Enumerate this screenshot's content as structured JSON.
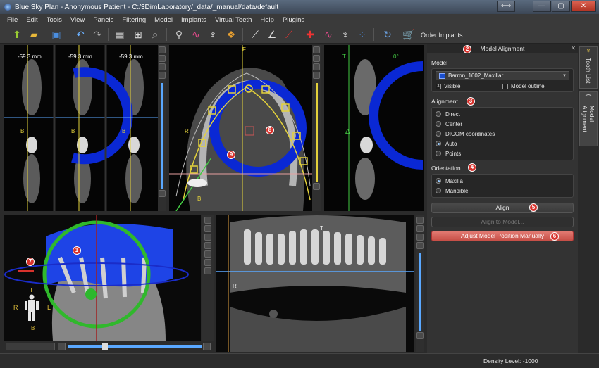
{
  "window": {
    "title": "Blue Sky Plan - Anonymous Patient - C:/3DimLaboratory/_data/_manual/data/default",
    "buttons": [
      "⟷",
      "—",
      "▢",
      "✕"
    ]
  },
  "menu": [
    "File",
    "Edit",
    "Tools",
    "View",
    "Panels",
    "Filtering",
    "Model",
    "Implants",
    "Virtual Teeth",
    "Help",
    "Plugins"
  ],
  "toolbar": {
    "order_label": "Order Implants"
  },
  "views": {
    "measures": [
      "-59.3 mm",
      "-59.3 mm",
      "-59.3 mm"
    ],
    "axial_labels": {
      "top": "F",
      "left": "R",
      "bottom": "B",
      "b_small": "2"
    },
    "cross_letters": [
      "B",
      "B",
      "B"
    ],
    "right_view_labels": {
      "t": "T",
      "deg": "0°",
      "delta": "Δ"
    },
    "coronal_labels": {
      "t": "T",
      "r": "R"
    },
    "orient_labels": {
      "t": "T",
      "r": "R",
      "l": "L",
      "b": "B"
    }
  },
  "panel": {
    "title": "Model Alignment",
    "model_label": "Model",
    "model_value": "Barron_1602_Maxillar",
    "visible_label": "Visible",
    "visible_checked": "X",
    "outline_label": "Model outline",
    "alignment_label": "Alignment",
    "alignment_options": [
      "Direct",
      "Center",
      "DICOM coordinates",
      "Auto",
      "Points"
    ],
    "alignment_selected": "Auto",
    "orientation_label": "Orientation",
    "orientation_options": [
      "Maxilla",
      "Mandible"
    ],
    "orientation_selected": "Maxilla",
    "align_button": "Align",
    "align_to_model_button": "Align to Model...",
    "adjust_button": "Adjust Model Position Manually",
    "swatch_color": "#1a4fd0"
  },
  "side_tabs": [
    "Tooth List",
    "Model Alignment"
  ],
  "badges": [
    "1",
    "2",
    "3",
    "4",
    "5",
    "6",
    "7",
    "8",
    "9"
  ],
  "status": {
    "density": "Density Level: -1000"
  }
}
